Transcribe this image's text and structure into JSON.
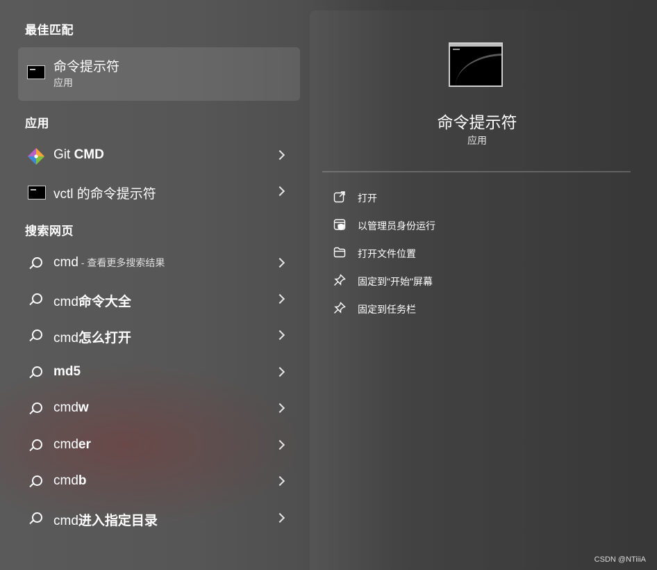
{
  "left": {
    "best_match_heading": "最佳匹配",
    "best_match": {
      "title": "命令提示符",
      "subtitle": "应用",
      "icon": "cmd-icon"
    },
    "apps_heading": "应用",
    "apps": [
      {
        "prefix": "Git ",
        "bold": "CMD",
        "icon": "git-icon"
      },
      {
        "prefix": "vctl 的命令提示符",
        "bold": "",
        "icon": "cmd-icon"
      }
    ],
    "web_heading": "搜索网页",
    "web_results": [
      {
        "prefix": "cmd",
        "bold": "",
        "sub": " - 查看更多搜索结果"
      },
      {
        "prefix": "cmd",
        "bold": "命令大全",
        "sub": ""
      },
      {
        "prefix": "cmd",
        "bold": "怎么打开",
        "sub": ""
      },
      {
        "prefix": "",
        "bold": "md5",
        "sub": ""
      },
      {
        "prefix": "cmd",
        "bold": "w",
        "sub": ""
      },
      {
        "prefix": "cmd",
        "bold": "er",
        "sub": ""
      },
      {
        "prefix": "cmd",
        "bold": "b",
        "sub": ""
      },
      {
        "prefix": "cmd",
        "bold": "进入指定目录",
        "sub": ""
      }
    ]
  },
  "right": {
    "title": "命令提示符",
    "subtitle": "应用",
    "actions": [
      {
        "label": "打开",
        "icon": "open-external-icon"
      },
      {
        "label": "以管理员身份运行",
        "icon": "shield-admin-icon"
      },
      {
        "label": "打开文件位置",
        "icon": "folder-icon"
      },
      {
        "label": "固定到\"开始\"屏幕",
        "icon": "pin-icon"
      },
      {
        "label": "固定到任务栏",
        "icon": "pin-icon"
      }
    ]
  },
  "watermark": "CSDN @NTiiiA"
}
